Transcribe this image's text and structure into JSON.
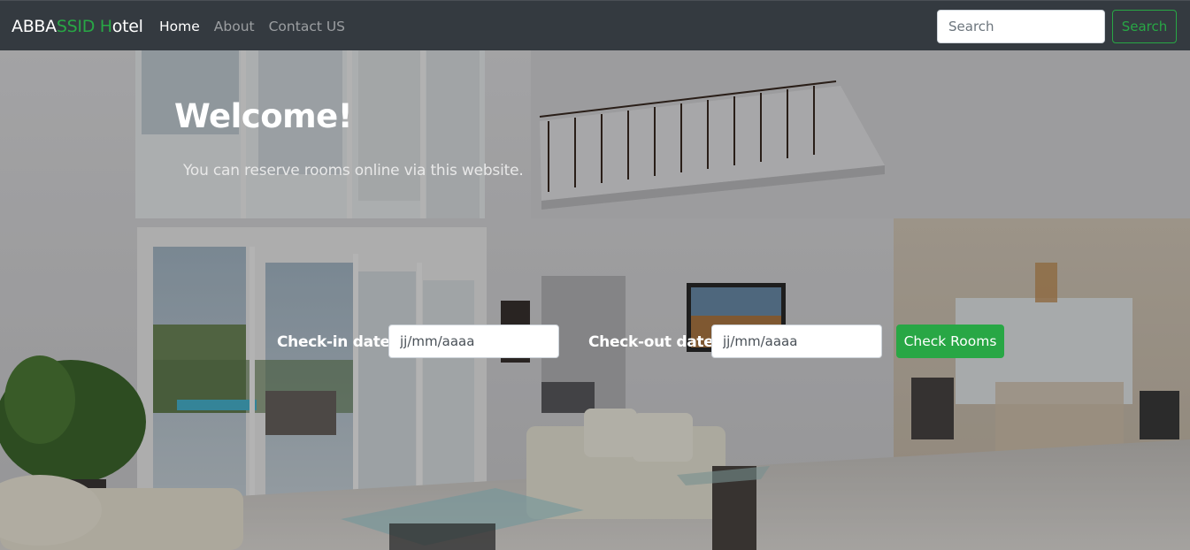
{
  "navbar": {
    "brand": {
      "part1": "ABBA",
      "part2": "SSID H",
      "part3": "otel"
    },
    "links": [
      {
        "label": "Home",
        "active": true
      },
      {
        "label": "About",
        "active": false
      },
      {
        "label": "Contact US",
        "active": false
      }
    ],
    "search": {
      "placeholder": "Search",
      "value": "",
      "button_label": "Search"
    }
  },
  "hero": {
    "title": "Welcome!",
    "subtitle": "You can reserve rooms online via this website.",
    "checkin": {
      "label": "Check-in date",
      "placeholder": "jj/mm/aaaa"
    },
    "checkout": {
      "label": "Check-out date",
      "placeholder": "jj/mm/aaaa"
    },
    "submit_label": "Check Rooms"
  },
  "colors": {
    "navbar_bg": "#343a40",
    "accent_green": "#28a745",
    "nav_link_muted": "rgba(255,255,255,0.5)"
  }
}
